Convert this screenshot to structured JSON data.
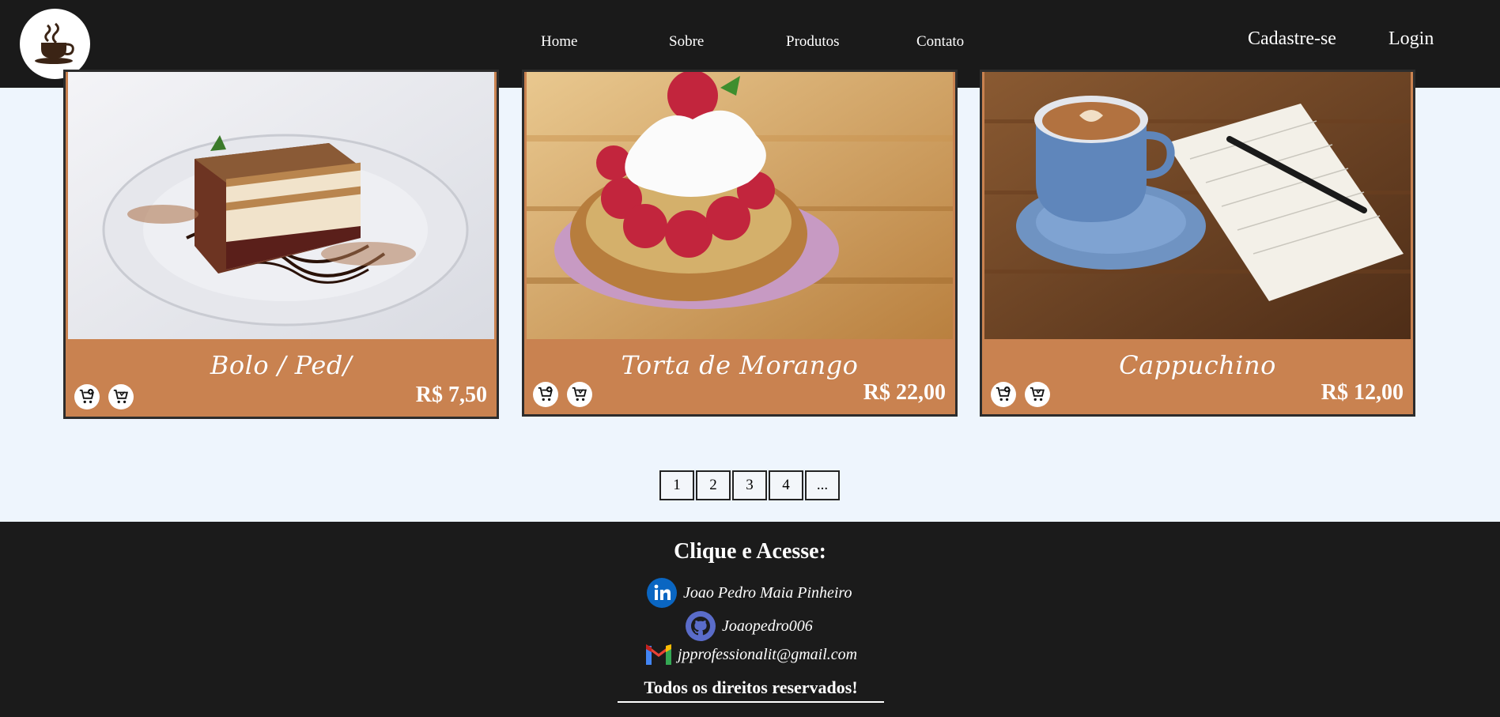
{
  "header": {
    "logo_icon": "coffee-cup-icon",
    "nav": [
      {
        "label": "Home"
      },
      {
        "label": "Sobre"
      },
      {
        "label": "Produtos"
      },
      {
        "label": "Contato"
      }
    ],
    "auth": {
      "signup": "Cadastre-se",
      "login": "Login"
    }
  },
  "products": [
    {
      "name": "Bolo / Ped/",
      "price": "R$ 7,50",
      "image": "cake-slice-image"
    },
    {
      "name": "Torta de Morango",
      "price": "R$ 22,00",
      "image": "raspberry-tart-image"
    },
    {
      "name": "Cappuchino",
      "price": "R$ 12,00",
      "image": "cappuccino-cup-image"
    }
  ],
  "product_icons": {
    "add": "cart-plus-icon",
    "cart": "cart-icon"
  },
  "pagination": [
    "1",
    "2",
    "3",
    "4",
    "..."
  ],
  "footer": {
    "heading": "Clique e Acesse:",
    "links": [
      {
        "icon": "linkedin-icon",
        "label": "Joao Pedro Maia Pinheiro"
      },
      {
        "icon": "github-icon",
        "label": "Joaopedro006"
      },
      {
        "icon": "gmail-icon",
        "label": "jpprofessionalit@gmail.com"
      }
    ],
    "rights": "Todos os direitos reservados!"
  },
  "colors": {
    "header_bg": "#1a1a1a",
    "page_bg": "#eef5fd",
    "card_bg": "#c98250",
    "footer_bg": "#1b1b1b"
  }
}
